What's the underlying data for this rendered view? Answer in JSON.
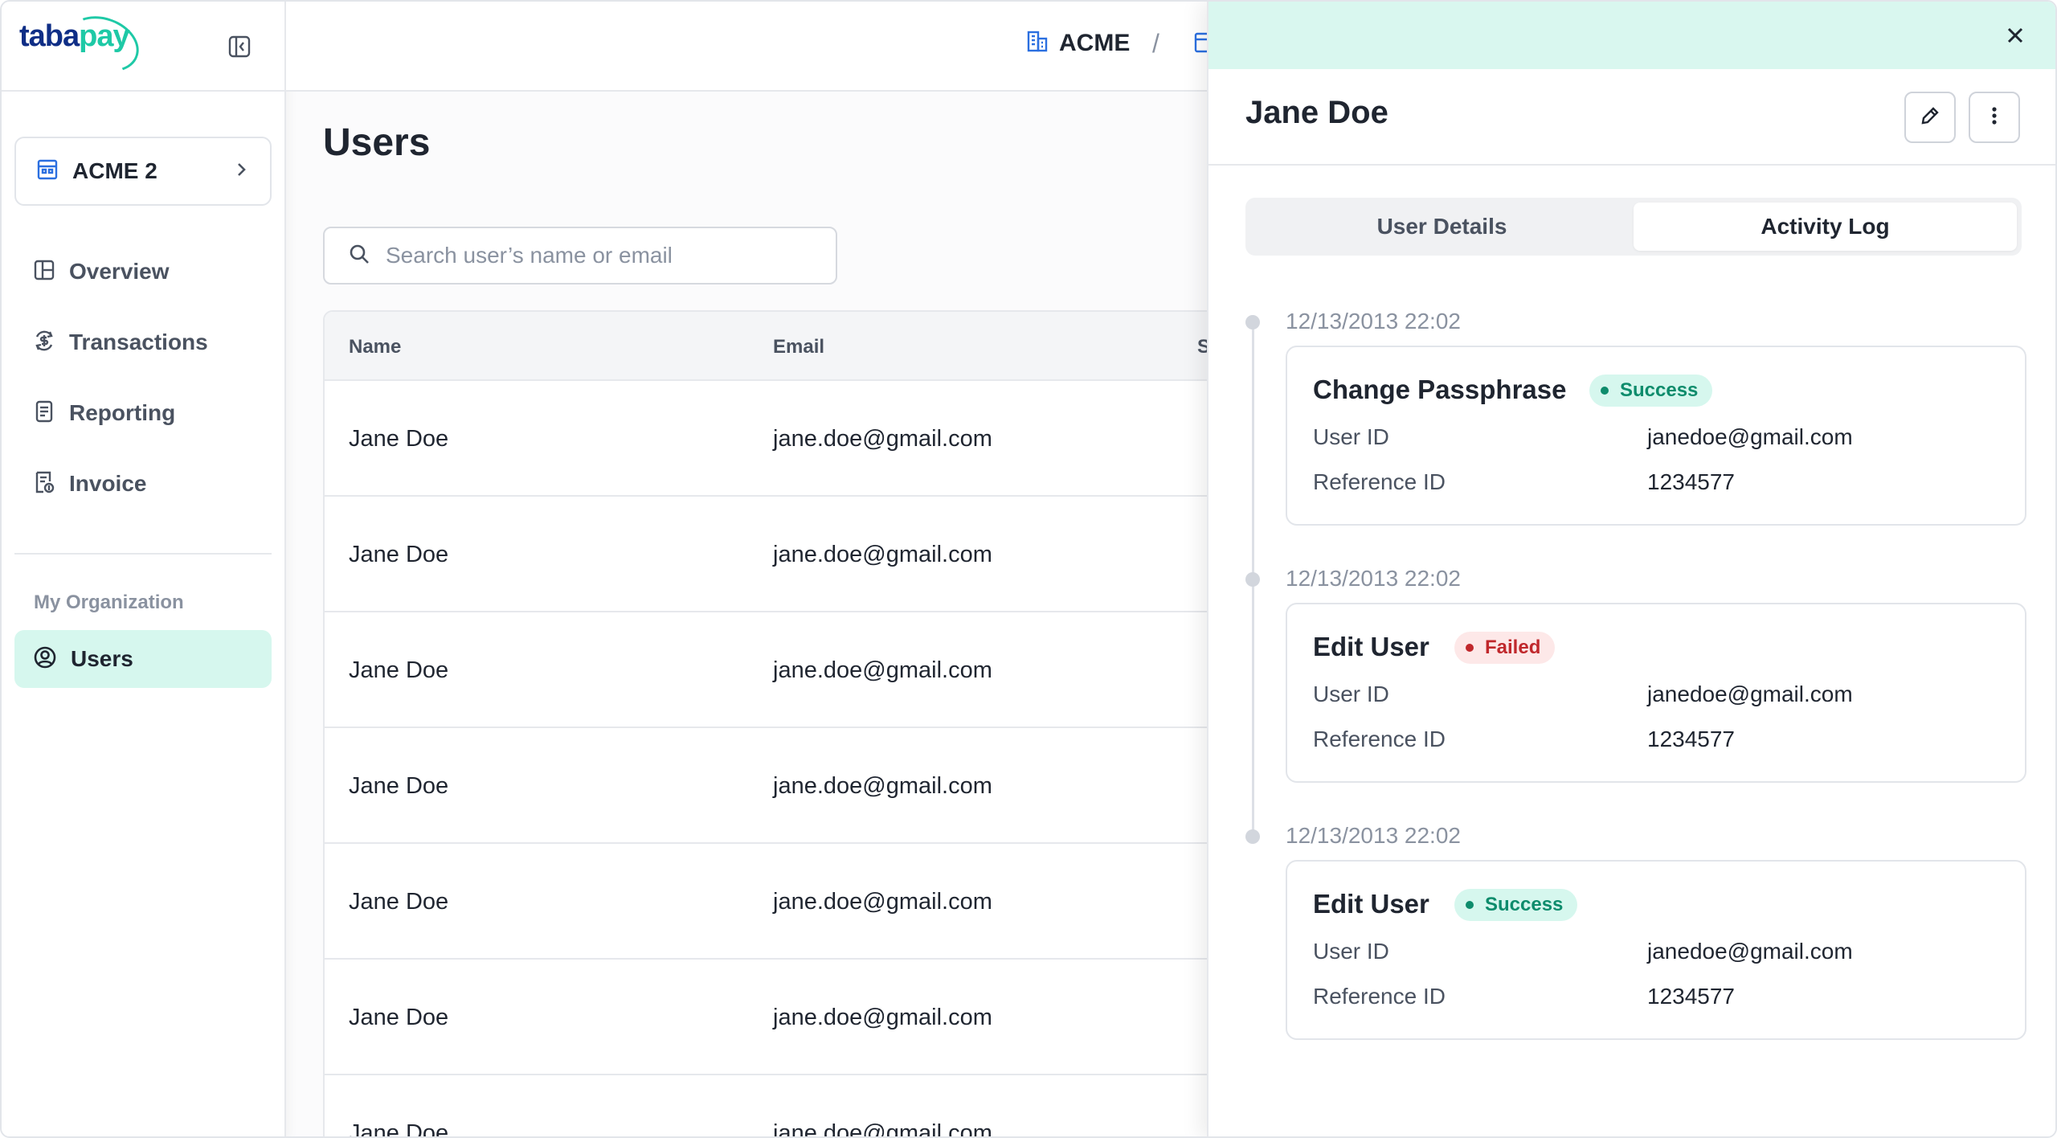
{
  "brand": {
    "logo_prefix": "taba",
    "logo_suffix": "pay",
    "color": "#1ec9a6"
  },
  "sidebar": {
    "org_name": "ACME 2",
    "items": [
      {
        "label": "Overview",
        "icon": "layout-icon"
      },
      {
        "label": "Transactions",
        "icon": "refresh-dollar-icon"
      },
      {
        "label": "Reporting",
        "icon": "document-icon"
      },
      {
        "label": "Invoice",
        "icon": "invoice-icon"
      }
    ],
    "section_label": "My Organization",
    "active_item": {
      "label": "Users",
      "icon": "user-circle-icon"
    }
  },
  "header": {
    "breadcrumb": "ACME",
    "separator": "/"
  },
  "main": {
    "title": "Users",
    "search_placeholder": "Search user’s name or email",
    "columns": [
      "Name",
      "Email",
      "S"
    ],
    "rows": [
      {
        "name": "Jane Doe",
        "email": "jane.doe@gmail.com",
        "status_color": "#d6f7ee"
      },
      {
        "name": "Jane Doe",
        "email": "jane.doe@gmail.com",
        "status_color": "#d6f7ee"
      },
      {
        "name": "Jane Doe",
        "email": "jane.doe@gmail.com",
        "status_color": "#d6f7ee"
      },
      {
        "name": "Jane Doe",
        "email": "jane.doe@gmail.com",
        "status_color": "#f0f1f3"
      },
      {
        "name": "Jane Doe",
        "email": "jane.doe@gmail.com",
        "status_color": "#f0f1f3"
      },
      {
        "name": "Jane Doe",
        "email": "jane.doe@gmail.com",
        "status_color": "#e8ebf0"
      },
      {
        "name": "Jane Doe",
        "email": "jane.doe@gmail.com",
        "status_color": "#fdebd3"
      }
    ]
  },
  "drawer": {
    "title": "Jane Doe",
    "tabs": {
      "details": "User Details",
      "activity": "Activity Log"
    },
    "entries": [
      {
        "time": "12/13/2013 22:02",
        "action": "Change Passphrase",
        "status": "Success",
        "user_id_label": "User ID",
        "user_id": "janedoe@gmail.com",
        "ref_label": "Reference ID",
        "ref_id": "1234577"
      },
      {
        "time": "12/13/2013 22:02",
        "action": "Edit User",
        "status": "Failed",
        "user_id_label": "User ID",
        "user_id": "janedoe@gmail.com",
        "ref_label": "Reference ID",
        "ref_id": "1234577"
      },
      {
        "time": "12/13/2013 22:02",
        "action": "Edit User",
        "status": "Success",
        "user_id_label": "User ID",
        "user_id": "janedoe@gmail.com",
        "ref_label": "Reference ID",
        "ref_id": "1234577"
      }
    ]
  }
}
